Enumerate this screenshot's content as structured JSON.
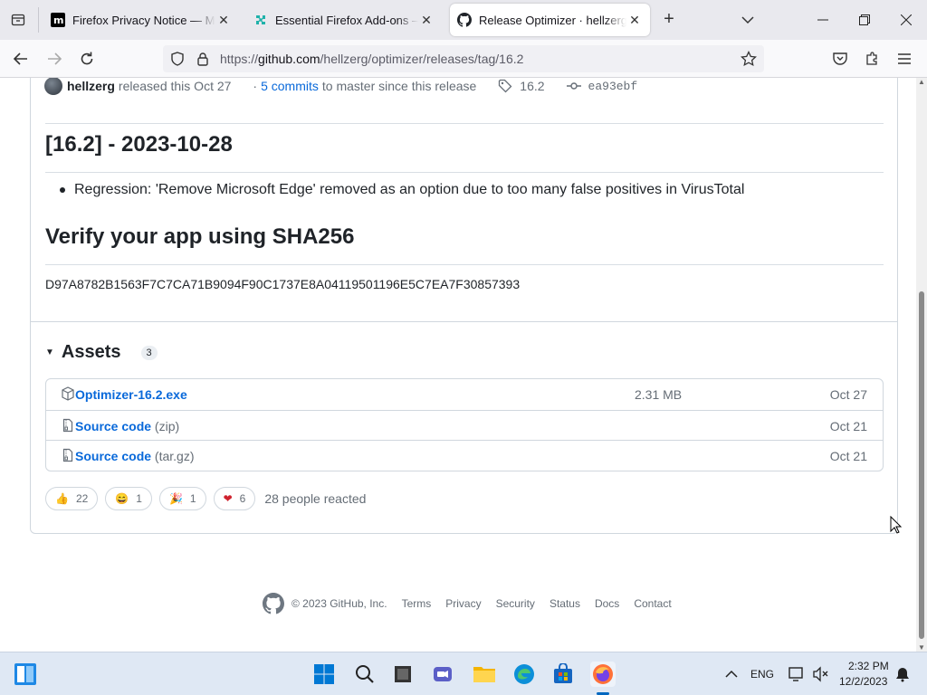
{
  "tabs": [
    {
      "title": "Firefox Privacy Notice — Mozilla",
      "favicon": "mozilla-m-icon",
      "active": false
    },
    {
      "title": "Essential Firefox Add-ons – Add-ons",
      "favicon": "addons-puzzle-icon",
      "active": false
    },
    {
      "title": "Release Optimizer · hellzerg/optimizer",
      "favicon": "github-icon",
      "active": true
    }
  ],
  "navbar": {
    "url_prefix": "https://",
    "url_domain": "github.com",
    "url_path": "/hellzerg/optimizer/releases/tag/16.2"
  },
  "release": {
    "author": "hellzerg",
    "released_text": "released this Oct 27",
    "commits_link": "5 commits",
    "commits_suffix": "to master since this release",
    "tag": "16.2",
    "commit": "ea93ebf",
    "heading": "[16.2] - 2023-10-28",
    "bullet": "Regression: 'Remove Microsoft Edge' removed as an option due to too many false positives in VirusTotal",
    "verify_heading": "Verify your app using SHA256",
    "sha256": "D97A8782B1563F7C7CA71B9094F90C1737E8A04119501196E5C7EA7F30857393"
  },
  "assets": {
    "label": "Assets",
    "count": "3",
    "rows": [
      {
        "name": "Optimizer-16.2.exe",
        "sub": "",
        "size": "2.31 MB",
        "date": "Oct 27",
        "icon": "package-icon"
      },
      {
        "name": "Source code",
        "sub": "(zip)",
        "size": "",
        "date": "Oct 21",
        "icon": "file-zip-icon"
      },
      {
        "name": "Source code",
        "sub": "(tar.gz)",
        "size": "",
        "date": "Oct 21",
        "icon": "file-zip-icon"
      }
    ]
  },
  "reactions": {
    "items": [
      {
        "emoji": "👍",
        "count": "22",
        "name": "thumbs-up"
      },
      {
        "emoji": "😄",
        "count": "1",
        "name": "laugh"
      },
      {
        "emoji": "🎉",
        "count": "1",
        "name": "hooray"
      },
      {
        "emoji": "❤",
        "count": "6",
        "name": "heart"
      }
    ],
    "summary": "28 people reacted"
  },
  "footer": {
    "copyright": "© 2023 GitHub, Inc.",
    "links": [
      "Terms",
      "Privacy",
      "Security",
      "Status",
      "Docs",
      "Contact"
    ]
  },
  "taskbar": {
    "lang": "ENG",
    "time": "2:32 PM",
    "date": "12/2/2023"
  }
}
